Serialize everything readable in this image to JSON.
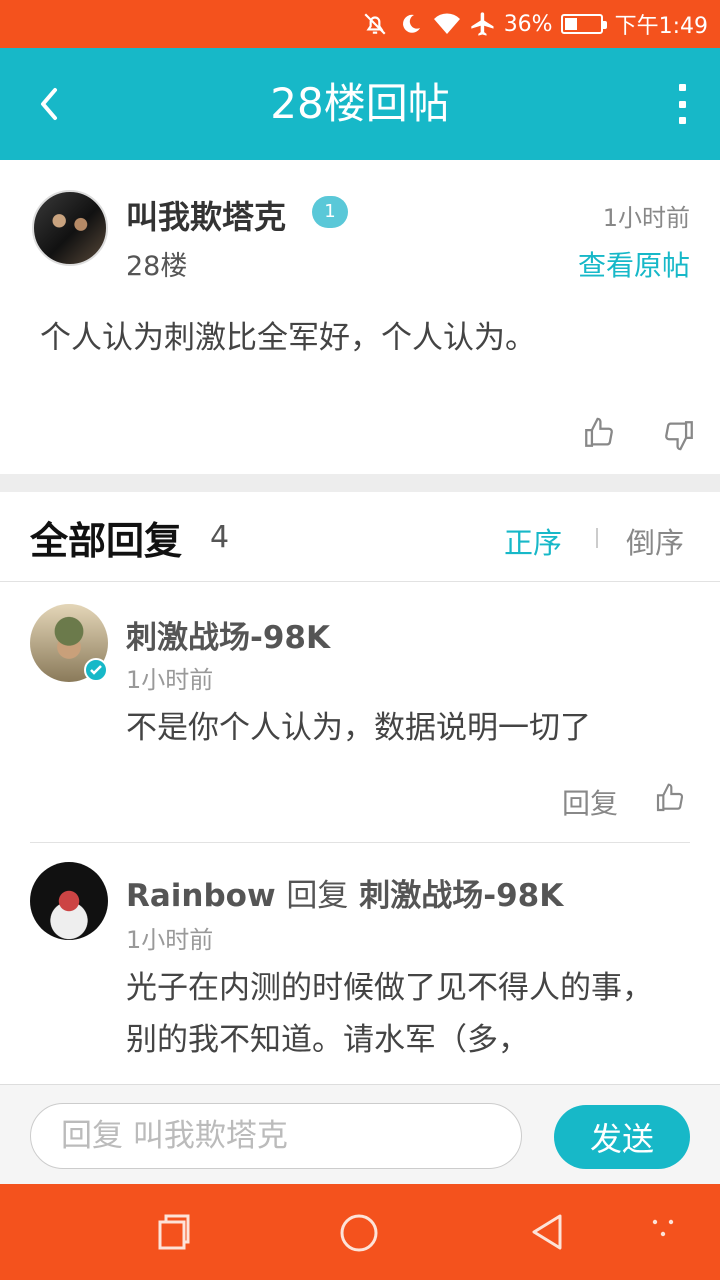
{
  "status_bar": {
    "battery_percent": "36%",
    "battery_level": 0.36,
    "time": "下午1:49",
    "icons": [
      "notifications-off-icon",
      "moon-icon",
      "wifi-icon",
      "airplane-icon",
      "battery-icon"
    ]
  },
  "app_bar": {
    "title": "28楼回帖",
    "back_icon": "chevron-left-icon",
    "more_icon": "more-vertical-icon"
  },
  "post": {
    "author": "叫我欺塔克",
    "level": "1",
    "floor": "28楼",
    "time": "1小时前",
    "view_original": "查看原帖",
    "content": "个人认为刺激比全军好，个人认为。"
  },
  "replies_header": {
    "title": "全部回复",
    "count": "4",
    "sort_asc": "正序",
    "sort_desc": "倒序"
  },
  "replies": [
    {
      "author": "刺激战场-98K",
      "time": "1小时前",
      "text": "不是你个人认为，数据说明一切了",
      "reply_label": "回复"
    },
    {
      "author": "Rainbow",
      "reply_word": "回复",
      "reply_to": "刺激战场-98K",
      "time": "1小时前",
      "text": "光子在内测的时候做了见不得人的事，别的我不知道。请水军（多，"
    }
  ],
  "input_bar": {
    "placeholder": "回复 叫我欺塔克",
    "send_label": "发送"
  },
  "colors": {
    "accent": "#17b8c8",
    "status_bar": "#f4521d",
    "nav_bar": "#f4521d"
  }
}
